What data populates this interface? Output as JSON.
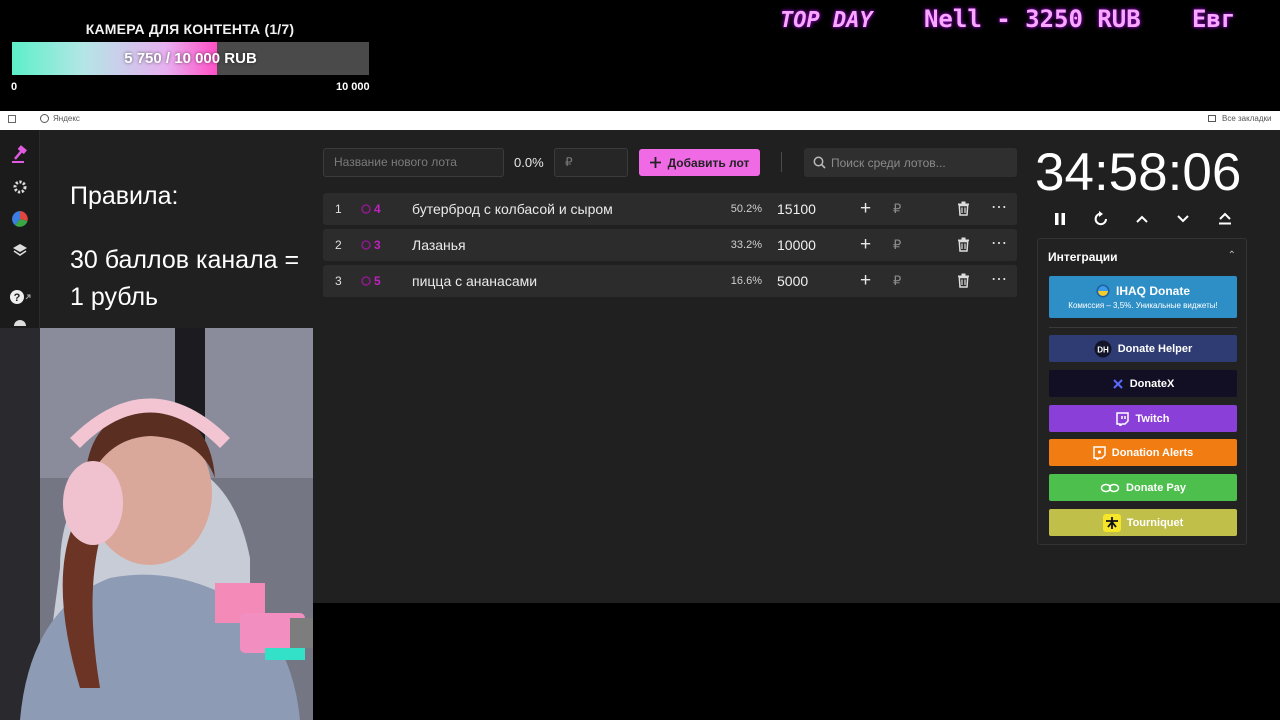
{
  "goal": {
    "title": "КАМЕРА ДЛЯ КОНТЕНТА (1/7)",
    "progress_text": "5 750 / 10 000 RUB",
    "current": 5750,
    "target": 10000,
    "progress_fraction": 0.575,
    "min_label": "0",
    "max_label": "10 000"
  },
  "ticker": {
    "items": [
      "TOP DAY",
      "Nell - 3250 RUB",
      "Евг"
    ]
  },
  "browser": {
    "bookmark_yandex": "Яндекс",
    "all_bookmarks": "Все закладки"
  },
  "rules": {
    "title": "Правила:",
    "text": "30 баллов канала = 1 рубль"
  },
  "toolbar": {
    "new_lot_placeholder": "Название нового лота",
    "percent": "0.0%",
    "amount_placeholder": "₽",
    "add_lot_label": "Добавить лот",
    "search_placeholder": "Поиск среди лотов..."
  },
  "lots": [
    {
      "num": "1",
      "fav": "4",
      "name": "бутерброд с колбасой и сыром",
      "share": "50.2%",
      "amount": "15100",
      "currency": "₽"
    },
    {
      "num": "2",
      "fav": "3",
      "name": "Лазанья",
      "share": "33.2%",
      "amount": "10000",
      "currency": "₽"
    },
    {
      "num": "3",
      "fav": "5",
      "name": "пицца с ананасами",
      "share": "16.6%",
      "amount": "5000",
      "currency": "₽"
    }
  ],
  "timer": {
    "value": "34:58:06"
  },
  "integrations": {
    "title": "Интеграции",
    "ihaq": {
      "label": "IHAQ Donate",
      "sub": "Комиссия – 3,5%. Уникальные виджеты!"
    },
    "buttons": [
      {
        "label": "Donate Helper",
        "icon": "donate-helper-icon",
        "color": "#2f3b73"
      },
      {
        "label": "DonateX",
        "icon": "donatex-icon",
        "color": "#120f25"
      },
      {
        "label": "Twitch",
        "icon": "twitch-icon",
        "color": "#8b3fd9"
      },
      {
        "label": "Donation Alerts",
        "icon": "donation-alerts-icon",
        "color": "#f07c12"
      },
      {
        "label": "Donate Pay",
        "icon": "donate-pay-icon",
        "color": "#4cbf4c"
      },
      {
        "label": "Tourniquet",
        "icon": "tourniquet-icon",
        "color": "#bfbf4a"
      }
    ]
  },
  "colors": {
    "accent": "#f06ae6",
    "ihaq": "#2e8fc7",
    "ticker": "#f8a8ff"
  }
}
